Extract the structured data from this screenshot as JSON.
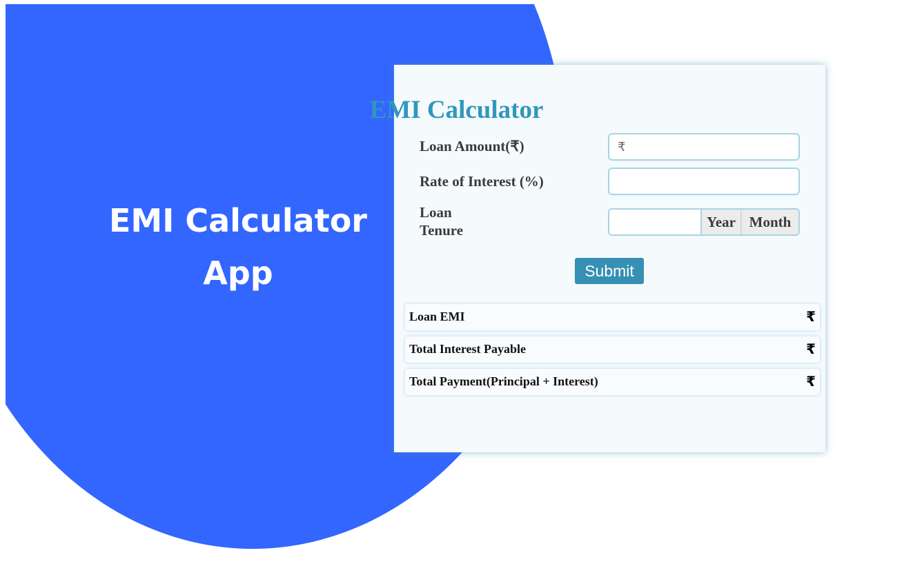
{
  "hero": {
    "line1": "EMI Calculator",
    "line2": "App"
  },
  "calculator": {
    "title": "EMI Calculator",
    "loan_amount": {
      "label": "Loan Amount(₹)",
      "value": "",
      "placeholder": "₹"
    },
    "interest_rate": {
      "label": "Rate of Interest (%)",
      "value": "",
      "placeholder": ""
    },
    "tenure": {
      "label_line1": "Loan",
      "label_line2": "Tenure",
      "value": "",
      "year_label": "Year",
      "month_label": "Month"
    },
    "submit_label": "Submit"
  },
  "results": [
    {
      "label": "Loan EMI",
      "value": "₹"
    },
    {
      "label": "Total Interest Payable",
      "value": "₹"
    },
    {
      "label": "Total Payment(Principal + Interest)",
      "value": "₹"
    }
  ],
  "colors": {
    "hero_background": "#3366ff",
    "card_background": "#f5fafd",
    "title_color": "#3197bd",
    "button_color": "#3590b3",
    "input_border": "#a9d3e2"
  }
}
